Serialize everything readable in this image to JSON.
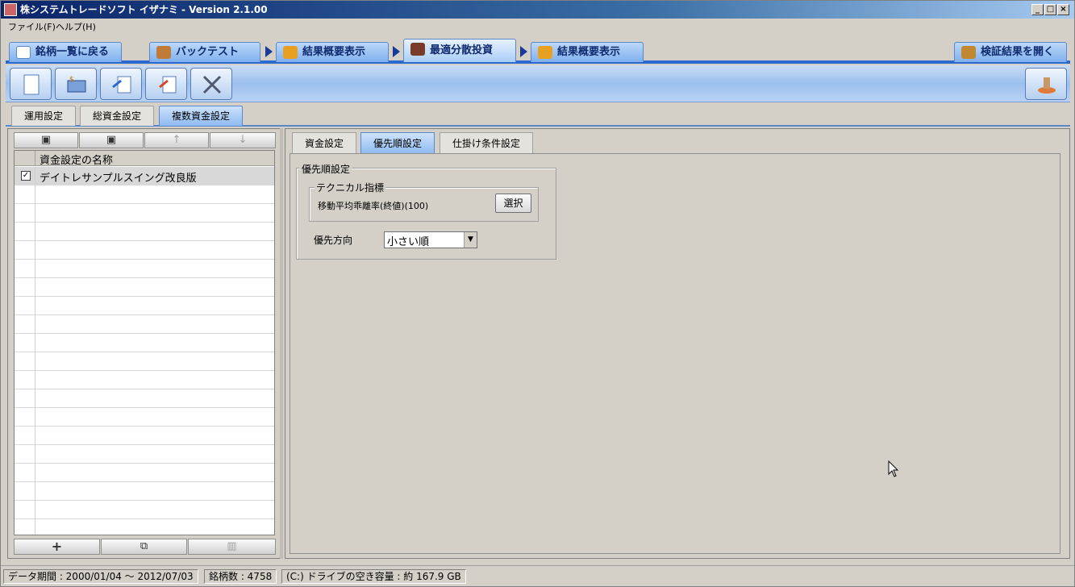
{
  "window": {
    "title": "株システムトレードソフト イザナミ - Version 2.1.00",
    "min": "_",
    "max": "□",
    "close": "×"
  },
  "menu": {
    "file": "ファイル(F)",
    "help": "ヘルプ(H)"
  },
  "nav": {
    "back": "銘柄一覧に戻る",
    "backtest": "バックテスト",
    "summary1": "結果概要表示",
    "optimize": "最適分散投資",
    "summary2": "結果概要表示",
    "open": "検証結果を開く"
  },
  "subtabs": [
    "運用設定",
    "総資金設定",
    "複数資金設定"
  ],
  "left": {
    "column_header": "資金設定の名称",
    "rows": [
      {
        "checked": "✓",
        "name": "デイトレサンプルスイング改良版"
      }
    ]
  },
  "right": {
    "tabs": [
      "資金設定",
      "優先順設定",
      "仕掛け条件設定"
    ],
    "group_title": "優先順設定",
    "tech_group": "テクニカル指標",
    "tech_value": "移動平均乖離率(終値)(100)",
    "select_btn": "選択",
    "dir_label": "優先方向",
    "dir_value": "小さい順"
  },
  "status": {
    "period": "データ期間 : 2000/01/04 ～ 2012/07/03",
    "count": "銘柄数 : 4758",
    "disk": "(C:) ドライブの空き容量 : 約 167.9 GB"
  }
}
